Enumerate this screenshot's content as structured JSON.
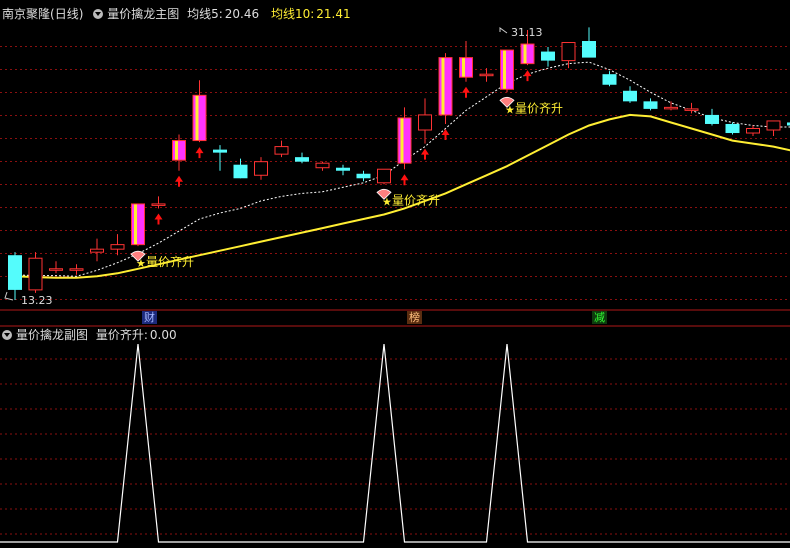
{
  "main_panel": {
    "stock_name": "南京聚隆",
    "period": "(日线)",
    "indicator_name": "量价擒龙主图",
    "ma5_label": "均线5:",
    "ma5_value": "20.46",
    "ma10_label": "均线10:",
    "ma10_value": "21.41",
    "high_marker": "31.13",
    "low_marker": "13.23",
    "signal_label": "量价齐升",
    "events": [
      "财",
      "榜",
      "减"
    ]
  },
  "sub_panel": {
    "indicator_name": "量价擒龙副图",
    "signal_name": "量价齐升:",
    "signal_value": "0.00"
  },
  "colors": {
    "background": "#000000",
    "up_candle": "#ff3333",
    "down_candle": "#54fcfc",
    "ma_yellow": "#ffee33",
    "ma_white": "#ffffff",
    "grid": "#8a1010",
    "separator": "#b01818",
    "signal_candle": "#ff33ff",
    "arrow": "#ff1111",
    "event_cai": "#6e8cff",
    "event_bang": "#ffbf7f",
    "event_jian": "#33ff33"
  },
  "chart_data": {
    "type": "candlestick",
    "x": [
      "1",
      "2",
      "3",
      "4",
      "5",
      "6",
      "7",
      "8",
      "9",
      "10",
      "11",
      "12",
      "13",
      "14",
      "15",
      "16",
      "17",
      "18",
      "19",
      "20",
      "21",
      "22",
      "23",
      "24",
      "25",
      "26",
      "27",
      "28",
      "29",
      "30",
      "31",
      "32",
      "33",
      "34",
      "35",
      "36",
      "37",
      "38",
      "39"
    ],
    "series": [
      {
        "values": [
          {
            "o": 16.2,
            "h": 16.4,
            "l": 13.23,
            "c": 13.9
          },
          {
            "o": 13.9,
            "h": 16.4,
            "l": 13.7,
            "c": 16.0
          },
          {
            "o": 15.3,
            "h": 15.8,
            "l": 15.0,
            "c": 15.3
          },
          {
            "o": 15.2,
            "h": 15.6,
            "l": 14.9,
            "c": 15.3
          },
          {
            "o": 16.4,
            "h": 17.3,
            "l": 15.8,
            "c": 16.6
          },
          {
            "o": 16.6,
            "h": 17.6,
            "l": 16.2,
            "c": 16.9
          },
          {
            "o": 16.9,
            "h": 19.6,
            "l": 16.8,
            "c": 19.6
          },
          {
            "o": 19.6,
            "h": 20.1,
            "l": 19.3,
            "c": 19.6
          },
          {
            "o": 22.5,
            "h": 24.2,
            "l": 21.8,
            "c": 23.8
          },
          {
            "o": 23.8,
            "h": 27.8,
            "l": 23.7,
            "c": 26.8
          },
          {
            "o": 23.2,
            "h": 23.5,
            "l": 21.8,
            "c": 23.0
          },
          {
            "o": 22.2,
            "h": 22.6,
            "l": 21.3,
            "c": 21.3
          },
          {
            "o": 21.5,
            "h": 22.7,
            "l": 21.2,
            "c": 22.4
          },
          {
            "o": 22.9,
            "h": 23.8,
            "l": 22.7,
            "c": 23.4
          },
          {
            "o": 22.7,
            "h": 23.0,
            "l": 22.3,
            "c": 22.4
          },
          {
            "o": 22.0,
            "h": 22.4,
            "l": 21.8,
            "c": 22.3
          },
          {
            "o": 22.0,
            "h": 22.2,
            "l": 21.5,
            "c": 21.8
          },
          {
            "o": 21.6,
            "h": 21.8,
            "l": 21.1,
            "c": 21.3
          },
          {
            "o": 21.0,
            "h": 21.9,
            "l": 20.9,
            "c": 21.9
          },
          {
            "o": 22.3,
            "h": 26.0,
            "l": 21.9,
            "c": 25.3
          },
          {
            "o": 24.5,
            "h": 26.6,
            "l": 23.6,
            "c": 25.5
          },
          {
            "o": 25.5,
            "h": 29.6,
            "l": 24.9,
            "c": 29.3
          },
          {
            "o": 28.0,
            "h": 30.4,
            "l": 27.7,
            "c": 29.3
          },
          {
            "o": 28.2,
            "h": 28.6,
            "l": 27.7,
            "c": 28.2
          },
          {
            "o": 27.2,
            "h": 29.8,
            "l": 27.0,
            "c": 29.8
          },
          {
            "o": 28.9,
            "h": 31.13,
            "l": 28.8,
            "c": 30.2
          },
          {
            "o": 29.7,
            "h": 30.0,
            "l": 28.7,
            "c": 29.1
          },
          {
            "o": 29.1,
            "h": 30.3,
            "l": 28.6,
            "c": 30.3
          },
          {
            "o": 30.4,
            "h": 31.3,
            "l": 29.4,
            "c": 29.3
          },
          {
            "o": 28.2,
            "h": 28.4,
            "l": 27.4,
            "c": 27.5
          },
          {
            "o": 27.1,
            "h": 27.4,
            "l": 26.3,
            "c": 26.4
          },
          {
            "o": 26.4,
            "h": 26.6,
            "l": 25.8,
            "c": 25.9
          },
          {
            "o": 26.0,
            "h": 26.4,
            "l": 25.8,
            "c": 26.0
          },
          {
            "o": 25.9,
            "h": 26.3,
            "l": 25.6,
            "c": 25.9
          },
          {
            "o": 25.5,
            "h": 25.9,
            "l": 24.8,
            "c": 24.9
          },
          {
            "o": 24.9,
            "h": 25.0,
            "l": 24.2,
            "c": 24.3
          },
          {
            "o": 24.3,
            "h": 24.8,
            "l": 24.1,
            "c": 24.6
          },
          {
            "o": 24.5,
            "h": 25.1,
            "l": 24.1,
            "c": 25.1
          },
          {
            "o": 25.0,
            "h": 25.2,
            "l": 24.6,
            "c": 24.8
          }
        ]
      },
      {
        "values": [
          14.8,
          14.75,
          14.7,
          14.7,
          14.8,
          15.0,
          15.3,
          15.6,
          15.9,
          16.2,
          16.5,
          16.8,
          17.1,
          17.4,
          17.7,
          18.0,
          18.3,
          18.6,
          18.9,
          19.3,
          19.8,
          20.3,
          20.9,
          21.5,
          22.1,
          22.8,
          23.5,
          24.2,
          24.8,
          25.2,
          25.5,
          25.4,
          25.0,
          24.6,
          24.2,
          23.8,
          23.6,
          23.4,
          23.1
        ]
      },
      {
        "values": [
          14.9,
          14.85,
          14.85,
          14.8,
          15.2,
          15.7,
          16.3,
          17.0,
          17.8,
          18.6,
          19.0,
          19.3,
          19.8,
          20.1,
          20.3,
          20.4,
          20.7,
          21.0,
          21.5,
          22.5,
          23.4,
          24.6,
          25.8,
          26.7,
          27.6,
          28.2,
          28.6,
          28.9,
          29.0,
          28.5,
          27.8,
          27.0,
          26.3,
          25.8,
          25.3,
          25.0,
          24.8,
          24.7,
          24.7
        ]
      },
      {
        "values": [
          0,
          0,
          0,
          0,
          0,
          0,
          1,
          0,
          0,
          0,
          0,
          0,
          0,
          0,
          0,
          0,
          0,
          0,
          1,
          0,
          0,
          0,
          0,
          0,
          1,
          0,
          0,
          0,
          0,
          0,
          0,
          0,
          0,
          0,
          0,
          0,
          0,
          0,
          0
        ]
      }
    ],
    "signals": [
      6,
      18,
      24
    ],
    "arrows": [
      7,
      8,
      9,
      19,
      20,
      21,
      22,
      25
    ]
  }
}
